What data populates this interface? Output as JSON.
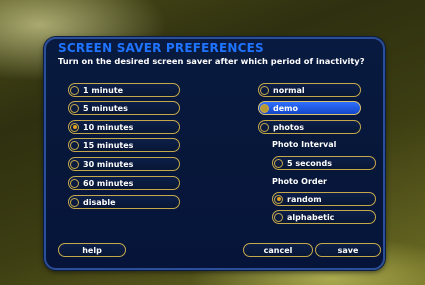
{
  "title": "SCREEN SAVER PREFERENCES",
  "subtitle": "Turn on the desired screen saver after which period of inactivity?",
  "timeouts": [
    {
      "label": "1 minute",
      "selected": false
    },
    {
      "label": "5 minutes",
      "selected": false
    },
    {
      "label": "10 minutes",
      "selected": true
    },
    {
      "label": "15 minutes",
      "selected": false
    },
    {
      "label": "30 minutes",
      "selected": false
    },
    {
      "label": "60 minutes",
      "selected": false
    },
    {
      "label": "disable",
      "selected": false
    }
  ],
  "saver_types": [
    {
      "label": "normal",
      "selected": false
    },
    {
      "label": "demo",
      "selected": false,
      "highlighted": true
    },
    {
      "label": "photos",
      "selected": false
    }
  ],
  "photo_interval": {
    "heading": "Photo Interval",
    "value": "5 seconds"
  },
  "photo_order": {
    "heading": "Photo Order",
    "options": [
      {
        "label": "random",
        "selected": true
      },
      {
        "label": "alphabetic",
        "selected": false
      }
    ]
  },
  "buttons": {
    "help": "help",
    "cancel": "cancel",
    "save": "save"
  },
  "colors": {
    "title": "#1e73ff",
    "panel": "#07173a",
    "border_gold": "#c5a84a",
    "highlight": "#2f6fff"
  }
}
